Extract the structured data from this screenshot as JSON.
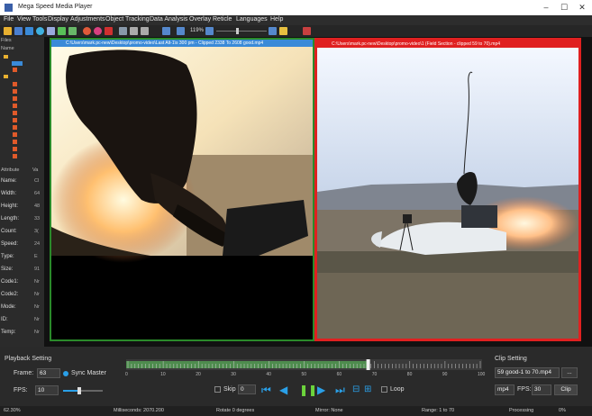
{
  "window": {
    "title": "Mega Speed Media Player",
    "minimize": "–",
    "maximize": "☐",
    "close": "✕"
  },
  "menu": [
    "File",
    "View",
    "Tools",
    "Display",
    "Adjustments",
    "Object Tracking",
    "Data Analysis",
    "Overlay",
    "Reticle",
    "Languages",
    "Help"
  ],
  "toolbar": {
    "zoom": "119%"
  },
  "left_panel": {
    "tabs": {
      "files": "Files",
      "name": "Name",
      "attributes": "Attribute",
      "value": "Va"
    },
    "properties": [
      {
        "name": "Name:",
        "value": "Cl"
      },
      {
        "name": "Width:",
        "value": "64"
      },
      {
        "name": "Height:",
        "value": "48"
      },
      {
        "name": "Length:",
        "value": "33"
      },
      {
        "name": "Count:",
        "value": "3("
      },
      {
        "name": "Speed:",
        "value": "24"
      },
      {
        "name": "Type:",
        "value": "E"
      },
      {
        "name": "Size:",
        "value": "91"
      },
      {
        "name": "Code1:",
        "value": "Nr"
      },
      {
        "name": "Code2:",
        "value": "Nr"
      },
      {
        "name": "Mode:",
        "value": "Nr"
      },
      {
        "name": "ID:",
        "value": "Nr"
      },
      {
        "name": "Temp:",
        "value": "Nr"
      }
    ]
  },
  "videos": [
    {
      "caption": "C:\\Users\\mark.pc-new\\Desktop\\promo-video\\Last Alt-1\\s 300 pm - Clipped 2338 To 2608 good.mp4",
      "border": "#2a8a2a"
    },
    {
      "caption": "C:\\Users\\mark.pc-new\\Desktop\\promo-video\\1 (Field Section - clipped 59 to 70).mp4",
      "border": "#e02020"
    }
  ],
  "playback": {
    "heading": "Playback Setting",
    "frame_label": "Frame:",
    "frame_value": "63",
    "sync_label": "Sync Master",
    "fps_label": "FPS:",
    "fps_value": "10",
    "skip_label": "Skip",
    "skip_value": "0",
    "loop_label": "Loop",
    "timeline_ticks": [
      "0",
      "10",
      "20",
      "30",
      "40",
      "50",
      "60",
      "70",
      "80",
      "90",
      "100"
    ],
    "progress_fraction": 0.68
  },
  "clip": {
    "heading": "Clip Setting",
    "name_value": "59 good-1 to 70.mp4",
    "browse": "...",
    "format_value": "mp4",
    "fps_label": "FPS:",
    "fps_value": "30",
    "clip_button": "Clip"
  },
  "status": {
    "zoom": "62.30%",
    "milliseconds": "Milliseconds: 2070.200",
    "rotate": "Rotate 0 degrees",
    "mirror": "Mirror: None",
    "range": "Range: 1 to 70",
    "processing": "Processing",
    "percent": "0%"
  }
}
